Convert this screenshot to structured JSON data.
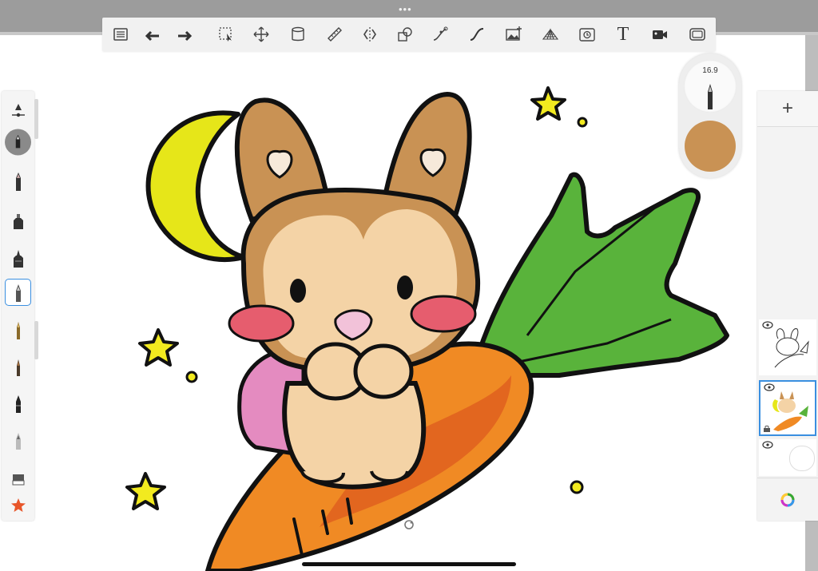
{
  "app": {
    "top_handle": "•••"
  },
  "toolbar": {
    "items": [
      {
        "name": "list-icon"
      },
      {
        "name": "undo-icon"
      },
      {
        "name": "redo-icon"
      },
      {
        "name": "selection-icon"
      },
      {
        "name": "transform-icon"
      },
      {
        "name": "fill-icon"
      },
      {
        "name": "ruler-icon"
      },
      {
        "name": "symmetry-icon"
      },
      {
        "name": "shape-icon"
      },
      {
        "name": "curve-icon"
      },
      {
        "name": "stroke-icon"
      },
      {
        "name": "image-icon"
      },
      {
        "name": "perspective-icon"
      },
      {
        "name": "timelapse-icon"
      },
      {
        "name": "text-icon"
      },
      {
        "name": "video-icon"
      },
      {
        "name": "fullscreen-icon"
      }
    ],
    "text_tool_label": "T"
  },
  "brush": {
    "size": "16.9",
    "color": "#c99254"
  },
  "layers": {
    "add_label": "+",
    "items": [
      {
        "name": "layer-line-art",
        "visible": true
      },
      {
        "name": "layer-color",
        "visible": true,
        "active": true
      },
      {
        "name": "layer-empty",
        "visible": true
      }
    ]
  },
  "colors": {
    "bunny_fur": "#c99254",
    "bunny_face": "#f4d3a6",
    "moon": "#e6e619",
    "carrot": "#f08a24",
    "carrot_shadow": "#e2661f",
    "leaf": "#59b33b",
    "blush": "#e65d6e",
    "nose": "#f2c2d9",
    "backpack": "#e48bc0",
    "star": "#f2ea1f"
  }
}
